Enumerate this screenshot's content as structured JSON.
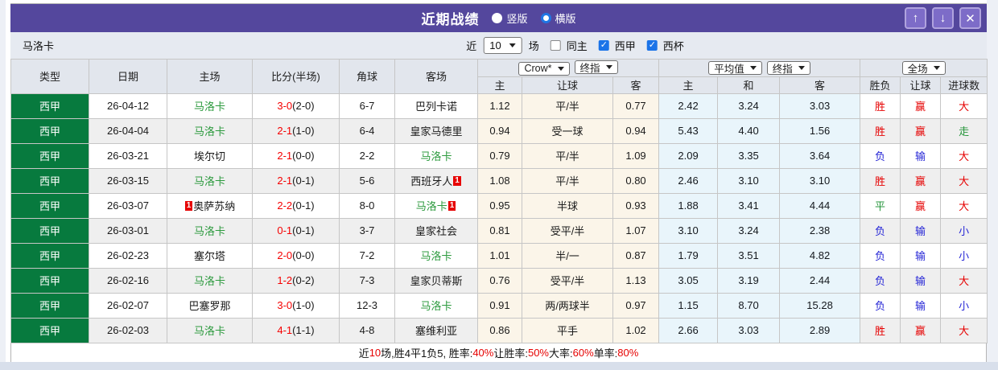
{
  "titlebar": {
    "title": "近期战绩",
    "radios": [
      {
        "label": "竖版",
        "selected": false
      },
      {
        "label": "横版",
        "selected": true
      }
    ],
    "icons": {
      "up": "↑",
      "down": "↓",
      "close": "✕"
    }
  },
  "filter": {
    "team": "马洛卡",
    "near_label": "近",
    "recent_count": "10",
    "matches_label": "场",
    "checkboxes": [
      {
        "label": "同主",
        "checked": false
      },
      {
        "label": "西甲",
        "checked": true
      },
      {
        "label": "西杯",
        "checked": true
      }
    ]
  },
  "table": {
    "row_headers": [
      "类型",
      "日期",
      "主场",
      "比分(半场)",
      "角球",
      "客场"
    ],
    "groups": [
      {
        "dropdowns": [
          "Crow*",
          "终指"
        ],
        "cols": [
          "主",
          "让球",
          "客"
        ]
      },
      {
        "dropdowns": [
          "平均值",
          "终指"
        ],
        "cols": [
          "主",
          "和",
          "客"
        ]
      },
      {
        "dropdowns": [
          "全场"
        ],
        "cols": [
          "胜负",
          "让球",
          "进球数"
        ]
      }
    ],
    "rows": [
      {
        "league": "西甲",
        "date": "26-04-12",
        "home": "马洛卡",
        "home_self": true,
        "home_badge": null,
        "score": "3-0",
        "half": "(2-0)",
        "corners": "6-7",
        "away": "巴列卡诺",
        "away_self": false,
        "away_badge": null,
        "crow": [
          "1.12",
          "平/半",
          "0.77"
        ],
        "avg": [
          "2.42",
          "3.24",
          "3.03"
        ],
        "results": [
          {
            "t": "胜",
            "c": "red"
          },
          {
            "t": "赢",
            "c": "red"
          },
          {
            "t": "大",
            "c": "red"
          }
        ]
      },
      {
        "league": "西甲",
        "date": "26-04-04",
        "home": "马洛卡",
        "home_self": true,
        "home_badge": null,
        "score": "2-1",
        "half": "(1-0)",
        "corners": "6-4",
        "away": "皇家马德里",
        "away_self": false,
        "away_badge": null,
        "crow": [
          "0.94",
          "受一球",
          "0.94"
        ],
        "avg": [
          "5.43",
          "4.40",
          "1.56"
        ],
        "results": [
          {
            "t": "胜",
            "c": "red"
          },
          {
            "t": "赢",
            "c": "red"
          },
          {
            "t": "走",
            "c": "green"
          }
        ]
      },
      {
        "league": "西甲",
        "date": "26-03-21",
        "home": "埃尔切",
        "home_self": false,
        "home_badge": null,
        "score": "2-1",
        "half": "(0-0)",
        "corners": "2-2",
        "away": "马洛卡",
        "away_self": true,
        "away_badge": null,
        "crow": [
          "0.79",
          "平/半",
          "1.09"
        ],
        "avg": [
          "2.09",
          "3.35",
          "3.64"
        ],
        "results": [
          {
            "t": "负",
            "c": "blue"
          },
          {
            "t": "输",
            "c": "blue"
          },
          {
            "t": "大",
            "c": "red"
          }
        ]
      },
      {
        "league": "西甲",
        "date": "26-03-15",
        "home": "马洛卡",
        "home_self": true,
        "home_badge": null,
        "score": "2-1",
        "half": "(0-1)",
        "corners": "5-6",
        "away": "西班牙人",
        "away_self": false,
        "away_badge": "1",
        "crow": [
          "1.08",
          "平/半",
          "0.80"
        ],
        "avg": [
          "2.46",
          "3.10",
          "3.10"
        ],
        "results": [
          {
            "t": "胜",
            "c": "red"
          },
          {
            "t": "赢",
            "c": "red"
          },
          {
            "t": "大",
            "c": "red"
          }
        ]
      },
      {
        "league": "西甲",
        "date": "26-03-07",
        "home": "奥萨苏纳",
        "home_self": false,
        "home_badge": "1",
        "score": "2-2",
        "half": "(0-1)",
        "corners": "8-0",
        "away": "马洛卡",
        "away_self": true,
        "away_badge": "1",
        "crow": [
          "0.95",
          "半球",
          "0.93"
        ],
        "avg": [
          "1.88",
          "3.41",
          "4.44"
        ],
        "results": [
          {
            "t": "平",
            "c": "green"
          },
          {
            "t": "赢",
            "c": "red"
          },
          {
            "t": "大",
            "c": "red"
          }
        ]
      },
      {
        "league": "西甲",
        "date": "26-03-01",
        "home": "马洛卡",
        "home_self": true,
        "home_badge": null,
        "score": "0-1",
        "half": "(0-1)",
        "corners": "3-7",
        "away": "皇家社会",
        "away_self": false,
        "away_badge": null,
        "crow": [
          "0.81",
          "受平/半",
          "1.07"
        ],
        "avg": [
          "3.10",
          "3.24",
          "2.38"
        ],
        "results": [
          {
            "t": "负",
            "c": "blue"
          },
          {
            "t": "输",
            "c": "blue"
          },
          {
            "t": "小",
            "c": "blue"
          }
        ]
      },
      {
        "league": "西甲",
        "date": "26-02-23",
        "home": "塞尔塔",
        "home_self": false,
        "home_badge": null,
        "score": "2-0",
        "half": "(0-0)",
        "corners": "7-2",
        "away": "马洛卡",
        "away_self": true,
        "away_badge": null,
        "crow": [
          "1.01",
          "半/一",
          "0.87"
        ],
        "avg": [
          "1.79",
          "3.51",
          "4.82"
        ],
        "results": [
          {
            "t": "负",
            "c": "blue"
          },
          {
            "t": "输",
            "c": "blue"
          },
          {
            "t": "小",
            "c": "blue"
          }
        ]
      },
      {
        "league": "西甲",
        "date": "26-02-16",
        "home": "马洛卡",
        "home_self": true,
        "home_badge": null,
        "score": "1-2",
        "half": "(0-2)",
        "corners": "7-3",
        "away": "皇家贝蒂斯",
        "away_self": false,
        "away_badge": null,
        "crow": [
          "0.76",
          "受平/半",
          "1.13"
        ],
        "avg": [
          "3.05",
          "3.19",
          "2.44"
        ],
        "results": [
          {
            "t": "负",
            "c": "blue"
          },
          {
            "t": "输",
            "c": "blue"
          },
          {
            "t": "大",
            "c": "red"
          }
        ]
      },
      {
        "league": "西甲",
        "date": "26-02-07",
        "home": "巴塞罗那",
        "home_self": false,
        "home_badge": null,
        "score": "3-0",
        "half": "(1-0)",
        "corners": "12-3",
        "away": "马洛卡",
        "away_self": true,
        "away_badge": null,
        "crow": [
          "0.91",
          "两/两球半",
          "0.97"
        ],
        "avg": [
          "1.15",
          "8.70",
          "15.28"
        ],
        "results": [
          {
            "t": "负",
            "c": "blue"
          },
          {
            "t": "输",
            "c": "blue"
          },
          {
            "t": "小",
            "c": "blue"
          }
        ]
      },
      {
        "league": "西甲",
        "date": "26-02-03",
        "home": "马洛卡",
        "home_self": true,
        "home_badge": null,
        "score": "4-1",
        "half": "(1-1)",
        "corners": "4-8",
        "away": "塞维利亚",
        "away_self": false,
        "away_badge": null,
        "crow": [
          "0.86",
          "平手",
          "1.02"
        ],
        "avg": [
          "2.66",
          "3.03",
          "2.89"
        ],
        "results": [
          {
            "t": "胜",
            "c": "red"
          },
          {
            "t": "赢",
            "c": "red"
          },
          {
            "t": "大",
            "c": "red"
          }
        ]
      }
    ]
  },
  "footer": {
    "segments": [
      {
        "t": "近",
        "c": "k"
      },
      {
        "t": "10",
        "c": "r"
      },
      {
        "t": "场,胜4平1负5, 胜率:",
        "c": "k"
      },
      {
        "t": "40%",
        "c": "r"
      },
      {
        "t": " 让胜率:",
        "c": "k"
      },
      {
        "t": "50%",
        "c": "r"
      },
      {
        "t": " 大率:",
        "c": "k"
      },
      {
        "t": "60%",
        "c": "r"
      },
      {
        "t": " 单率:",
        "c": "k"
      },
      {
        "t": "80%",
        "c": "r"
      }
    ]
  },
  "colors": {
    "accent_purple": "#54479d",
    "league_green": "#077a3e",
    "win_red": "#e60000",
    "lose_blue": "#2626d6",
    "draw_green": "#27963c",
    "crow_bg": "#fbf5e9",
    "avg_bg": "#e9f5fb"
  }
}
